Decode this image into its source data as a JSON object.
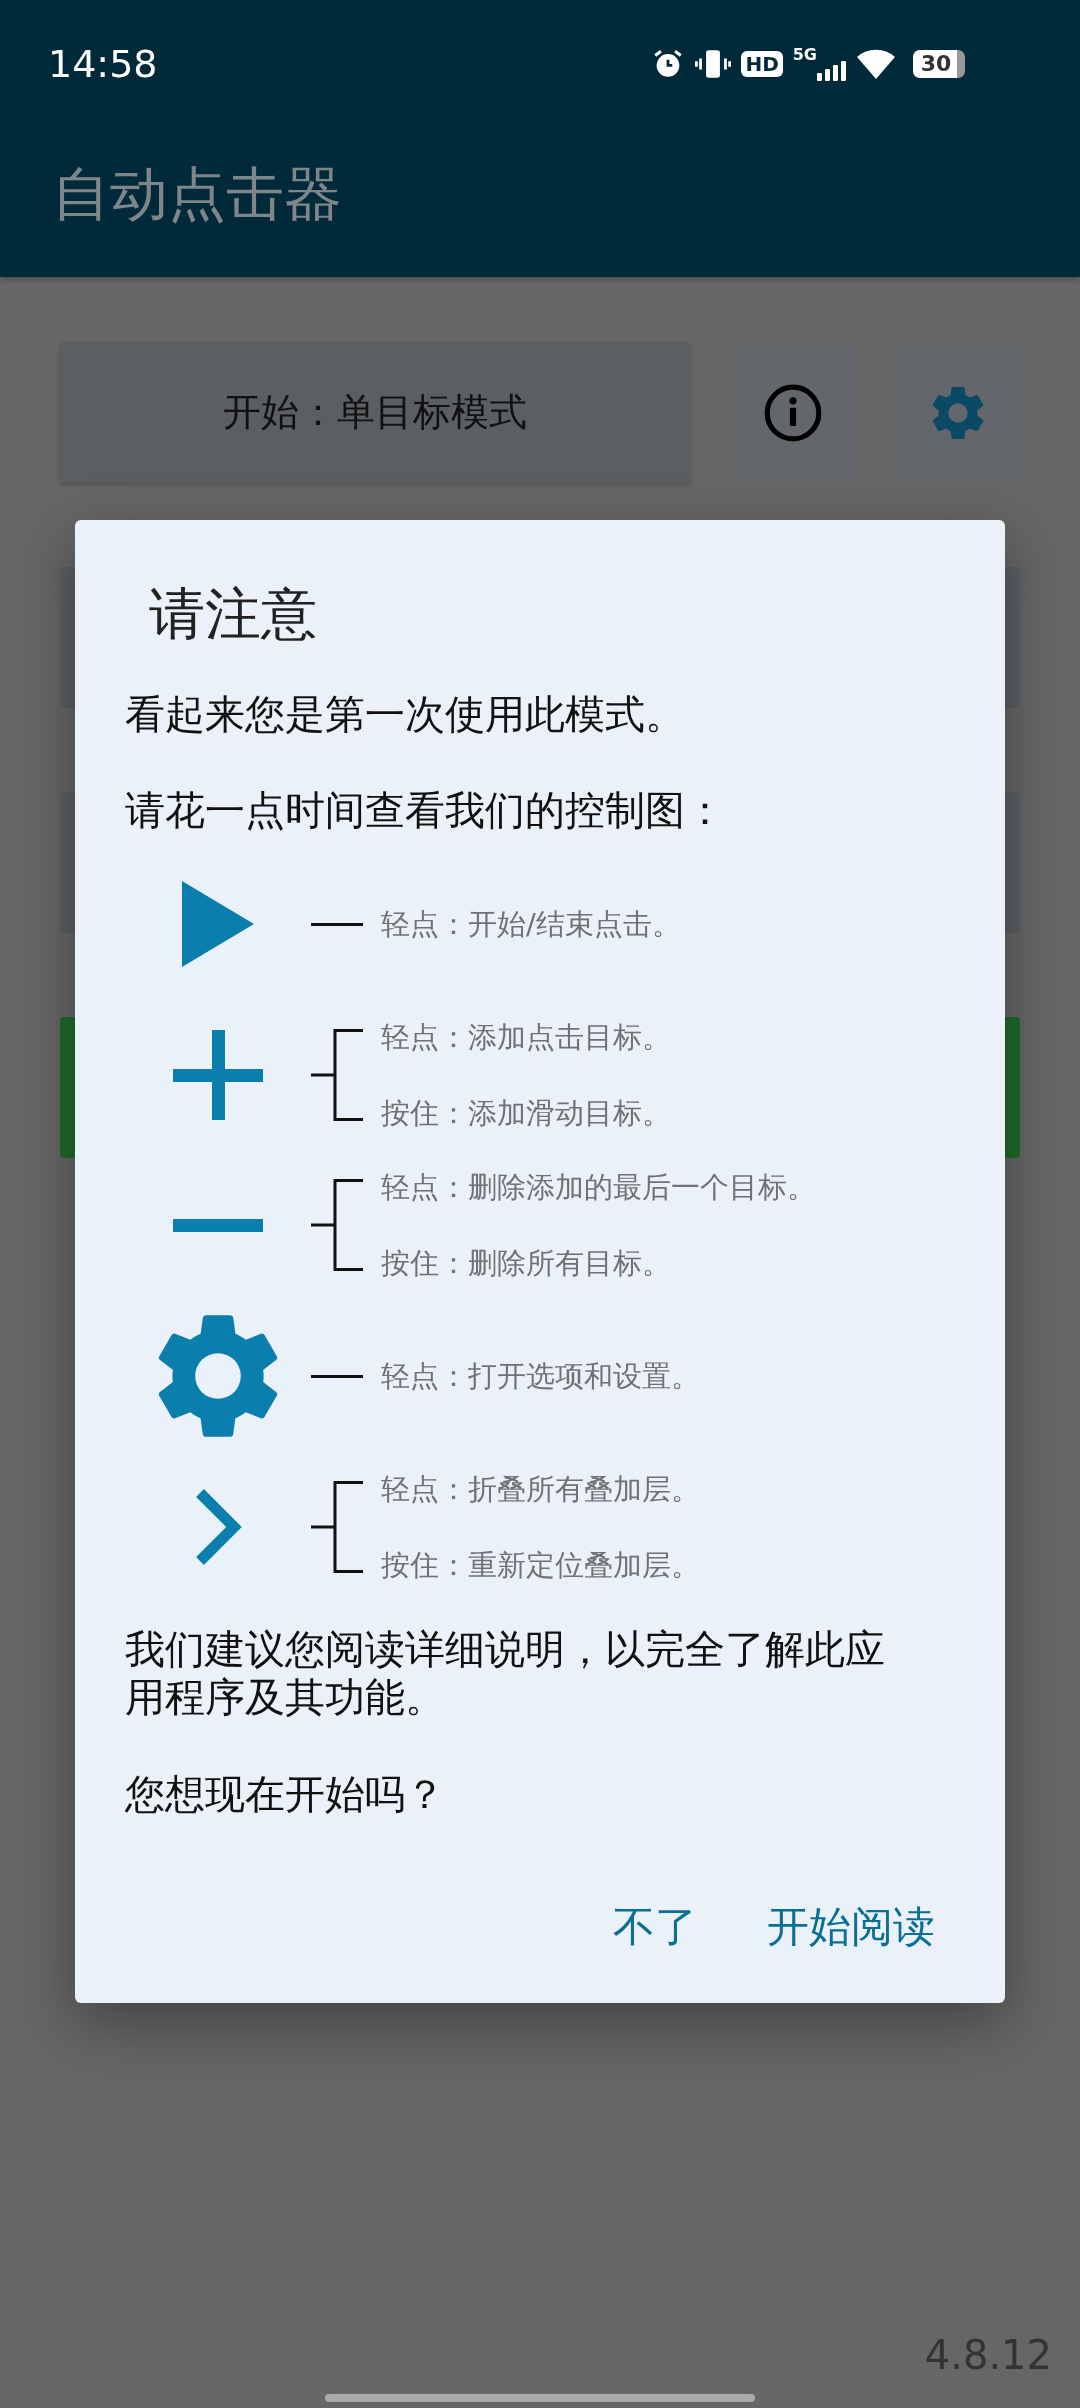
{
  "status_bar": {
    "time": "14:58",
    "hd_label": "HD",
    "network_label": "5G",
    "battery_text": "30"
  },
  "app_bar": {
    "title": "自动点击器"
  },
  "toolbar": {
    "start_button": "开始：单目标模式"
  },
  "background_cards": [
    {
      "kind": "plain"
    },
    {
      "kind": "plain"
    },
    {
      "kind": "accent"
    }
  ],
  "dialog": {
    "title": "请注意",
    "intro": "看起来您是第一次使用此模式。",
    "prompt": "请花一点时间查看我们的控制图：",
    "legend": [
      {
        "kind": "play",
        "entries": [
          "轻点：开始/结束点击。"
        ]
      },
      {
        "kind": "plus",
        "entries": [
          "轻点：添加点击目标。",
          "按住：添加滑动目标。"
        ]
      },
      {
        "kind": "minus",
        "entries": [
          "轻点：删除添加的最后一个目标。",
          "按住：删除所有目标。"
        ]
      },
      {
        "kind": "gear",
        "entries": [
          "轻点：打开选项和设置。"
        ]
      },
      {
        "kind": "chevron",
        "entries": [
          "轻点：折叠所有叠加层。",
          "按住：重新定位叠加层。"
        ]
      }
    ],
    "recommendation": "我们建议您阅读详细说明，以完全了解此应用程序及其功能。",
    "question": "您想现在开始吗？",
    "buttons": [
      "不了",
      "开始阅读"
    ]
  },
  "version": "4.8.12"
}
